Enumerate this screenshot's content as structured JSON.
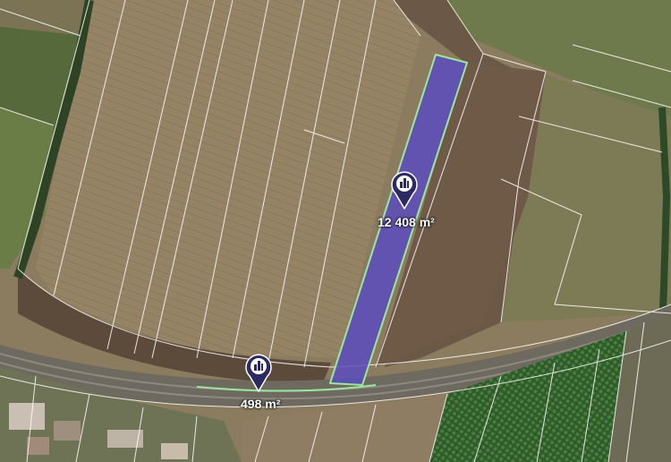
{
  "map": {
    "parcels": [
      {
        "area_label": "12 408 m²",
        "highlight_color": "#5a4cbe"
      },
      {
        "area_label": "498 m²"
      }
    ],
    "marker_color": "#2b2a63",
    "boundary_color": "#ffffff",
    "selected_outline_color": "#9be6a0"
  }
}
